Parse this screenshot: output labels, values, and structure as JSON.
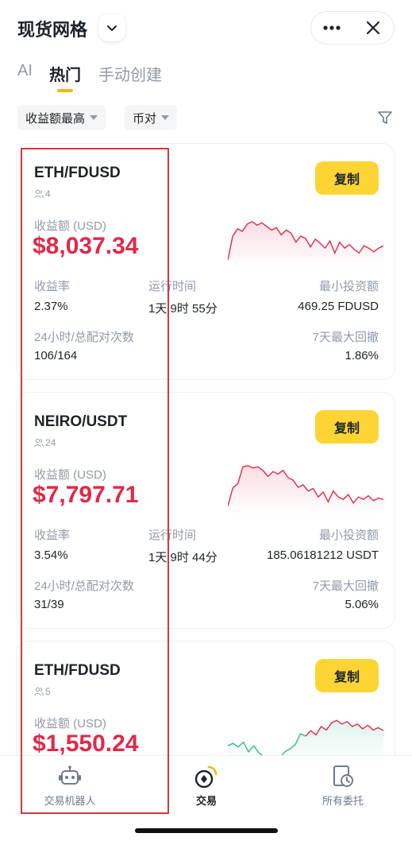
{
  "header": {
    "title": "现货网格",
    "dropdown_icon": "chevron-down-icon",
    "more_icon": "more-dots-icon",
    "close_icon": "close-icon"
  },
  "tabs": [
    {
      "label": "AI",
      "active": false
    },
    {
      "label": "热门",
      "active": true
    },
    {
      "label": "手动创建",
      "active": false
    }
  ],
  "filters": {
    "sort_label": "收益额最高",
    "pair_label": "币对",
    "filter_icon": "funnel-icon"
  },
  "labels": {
    "profit": "收益额 (USD)",
    "roi": "收益率",
    "runtime": "运行时间",
    "min_invest": "最小投资额",
    "matched": "24小时/总配对次数",
    "drawdown": "7天最大回撤",
    "copy": "复制"
  },
  "cards": [
    {
      "pair": "ETH/FDUSD",
      "users": "4",
      "profit": "$8,037.34",
      "roi": "2.37%",
      "runtime": "1天 9时 55分",
      "min_invest": "469.25 FDUSD",
      "matched": "106/164",
      "drawdown": "1.86%",
      "sparkline": [
        0.1,
        0.5,
        0.62,
        0.58,
        0.7,
        0.74,
        0.68,
        0.72,
        0.66,
        0.6,
        0.64,
        0.52,
        0.6,
        0.55,
        0.4,
        0.5,
        0.46,
        0.32,
        0.45,
        0.38,
        0.3,
        0.42,
        0.22,
        0.4,
        0.3,
        0.36,
        0.28,
        0.22,
        0.34,
        0.3,
        0.24,
        0.3,
        0.34
      ],
      "trend_color": "#e0294a"
    },
    {
      "pair": "NEIRO/USDT",
      "users": "24",
      "profit": "$7,797.71",
      "roi": "3.54%",
      "runtime": "1天 9时 44分",
      "min_invest": "185.06181212 USDT",
      "matched": "31/39",
      "drawdown": "5.06%",
      "sparkline": [
        0.15,
        0.45,
        0.52,
        0.8,
        0.82,
        0.78,
        0.8,
        0.74,
        0.64,
        0.72,
        0.68,
        0.74,
        0.62,
        0.58,
        0.46,
        0.5,
        0.4,
        0.44,
        0.3,
        0.38,
        0.22,
        0.4,
        0.3,
        0.26,
        0.34,
        0.2,
        0.3,
        0.26,
        0.32,
        0.24,
        0.28,
        0.26
      ],
      "trend_color": "#e0294a"
    },
    {
      "pair": "ETH/FDUSD",
      "users": "5",
      "profit": "$1,550.24",
      "roi": "",
      "runtime": "",
      "min_invest": "",
      "matched": "",
      "drawdown": "",
      "sparkline": [
        0.3,
        0.34,
        0.28,
        0.36,
        0.2,
        0.3,
        0.18,
        0.12,
        0.05,
        0.14,
        0.1,
        0.2,
        0.25,
        0.32,
        0.5,
        0.46,
        0.55,
        0.48,
        0.62,
        0.56,
        0.68,
        0.72,
        0.66,
        0.7,
        0.62,
        0.66,
        0.58,
        0.64,
        0.56,
        0.6,
        0.55
      ],
      "trend_color": "#2ebd85",
      "trend_color_late": "#e0294a"
    }
  ],
  "bottom_nav": [
    {
      "label": "交易机器人",
      "icon": "robot-icon",
      "active": false
    },
    {
      "label": "交易",
      "icon": "trade-icon",
      "active": true
    },
    {
      "label": "所有委托",
      "icon": "orders-clock-icon",
      "active": false
    }
  ]
}
